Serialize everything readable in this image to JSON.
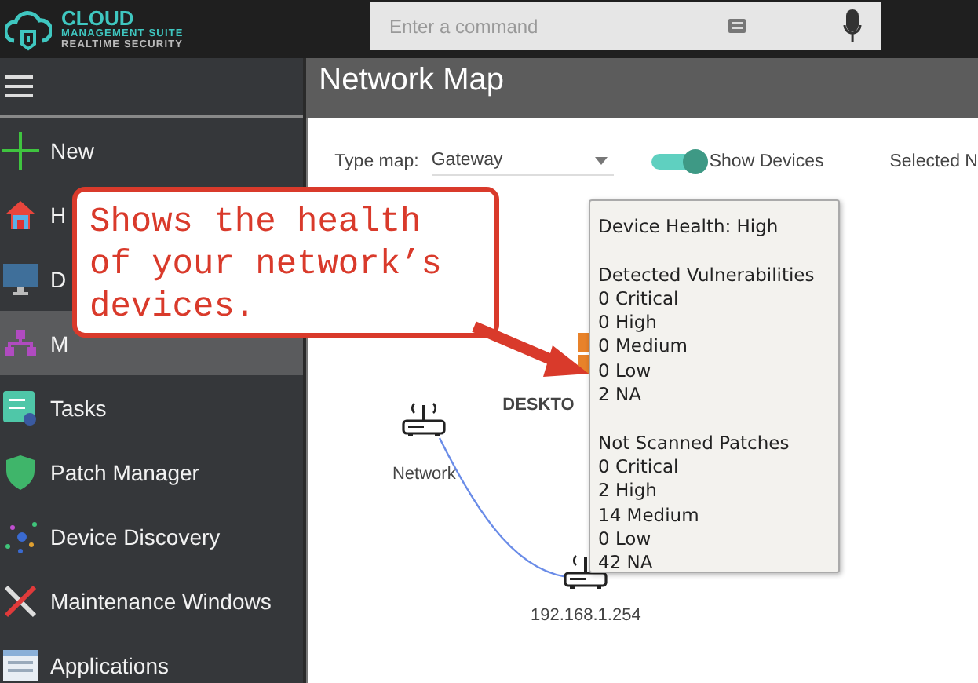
{
  "header": {
    "logo": {
      "title": "CLOUD",
      "line_1": "MANAGEMENT SUITE",
      "line_2": "REALTIME SECURITY"
    },
    "command_field": {
      "placeholder": "Enter a command"
    }
  },
  "sidebar": {
    "items": [
      {
        "label": "New",
        "selected": false
      },
      {
        "label": "H",
        "selected": false
      },
      {
        "label": "D",
        "selected": false
      },
      {
        "label": "M",
        "selected": true
      },
      {
        "label": "Tasks",
        "selected": false
      },
      {
        "label": "Patch Manager",
        "selected": false
      },
      {
        "label": "Device Discovery",
        "selected": false
      },
      {
        "label": "Maintenance Windows",
        "selected": false
      },
      {
        "label": "Applications",
        "selected": false
      }
    ]
  },
  "page_title": "Network Map",
  "toolbar": {
    "type_map_label": "Type map:",
    "type_map_value": "Gateway",
    "toggle": {
      "label": "Show Devices",
      "on": true
    },
    "selected_label": "Selected N"
  },
  "map": {
    "nodes": [
      {
        "label": "DESKTO",
        "kind": "desktop"
      },
      {
        "label": "Network",
        "kind": "router"
      },
      {
        "label": "192.168.1.254",
        "kind": "router"
      }
    ]
  },
  "tooltip": {
    "heading": "Device Health: High",
    "sections": [
      {
        "title": "Detected Vulnerabilities",
        "lines": [
          "0 Critical",
          "0 High",
          "0 Medium",
          "0 Low",
          "2 NA"
        ]
      },
      {
        "title": "Not Scanned Patches",
        "lines": [
          "0 Critical",
          "2 High",
          "14 Medium",
          "0 Low",
          "42 NA"
        ]
      }
    ]
  },
  "callout": {
    "text": "Shows the health of your network’s devices."
  }
}
